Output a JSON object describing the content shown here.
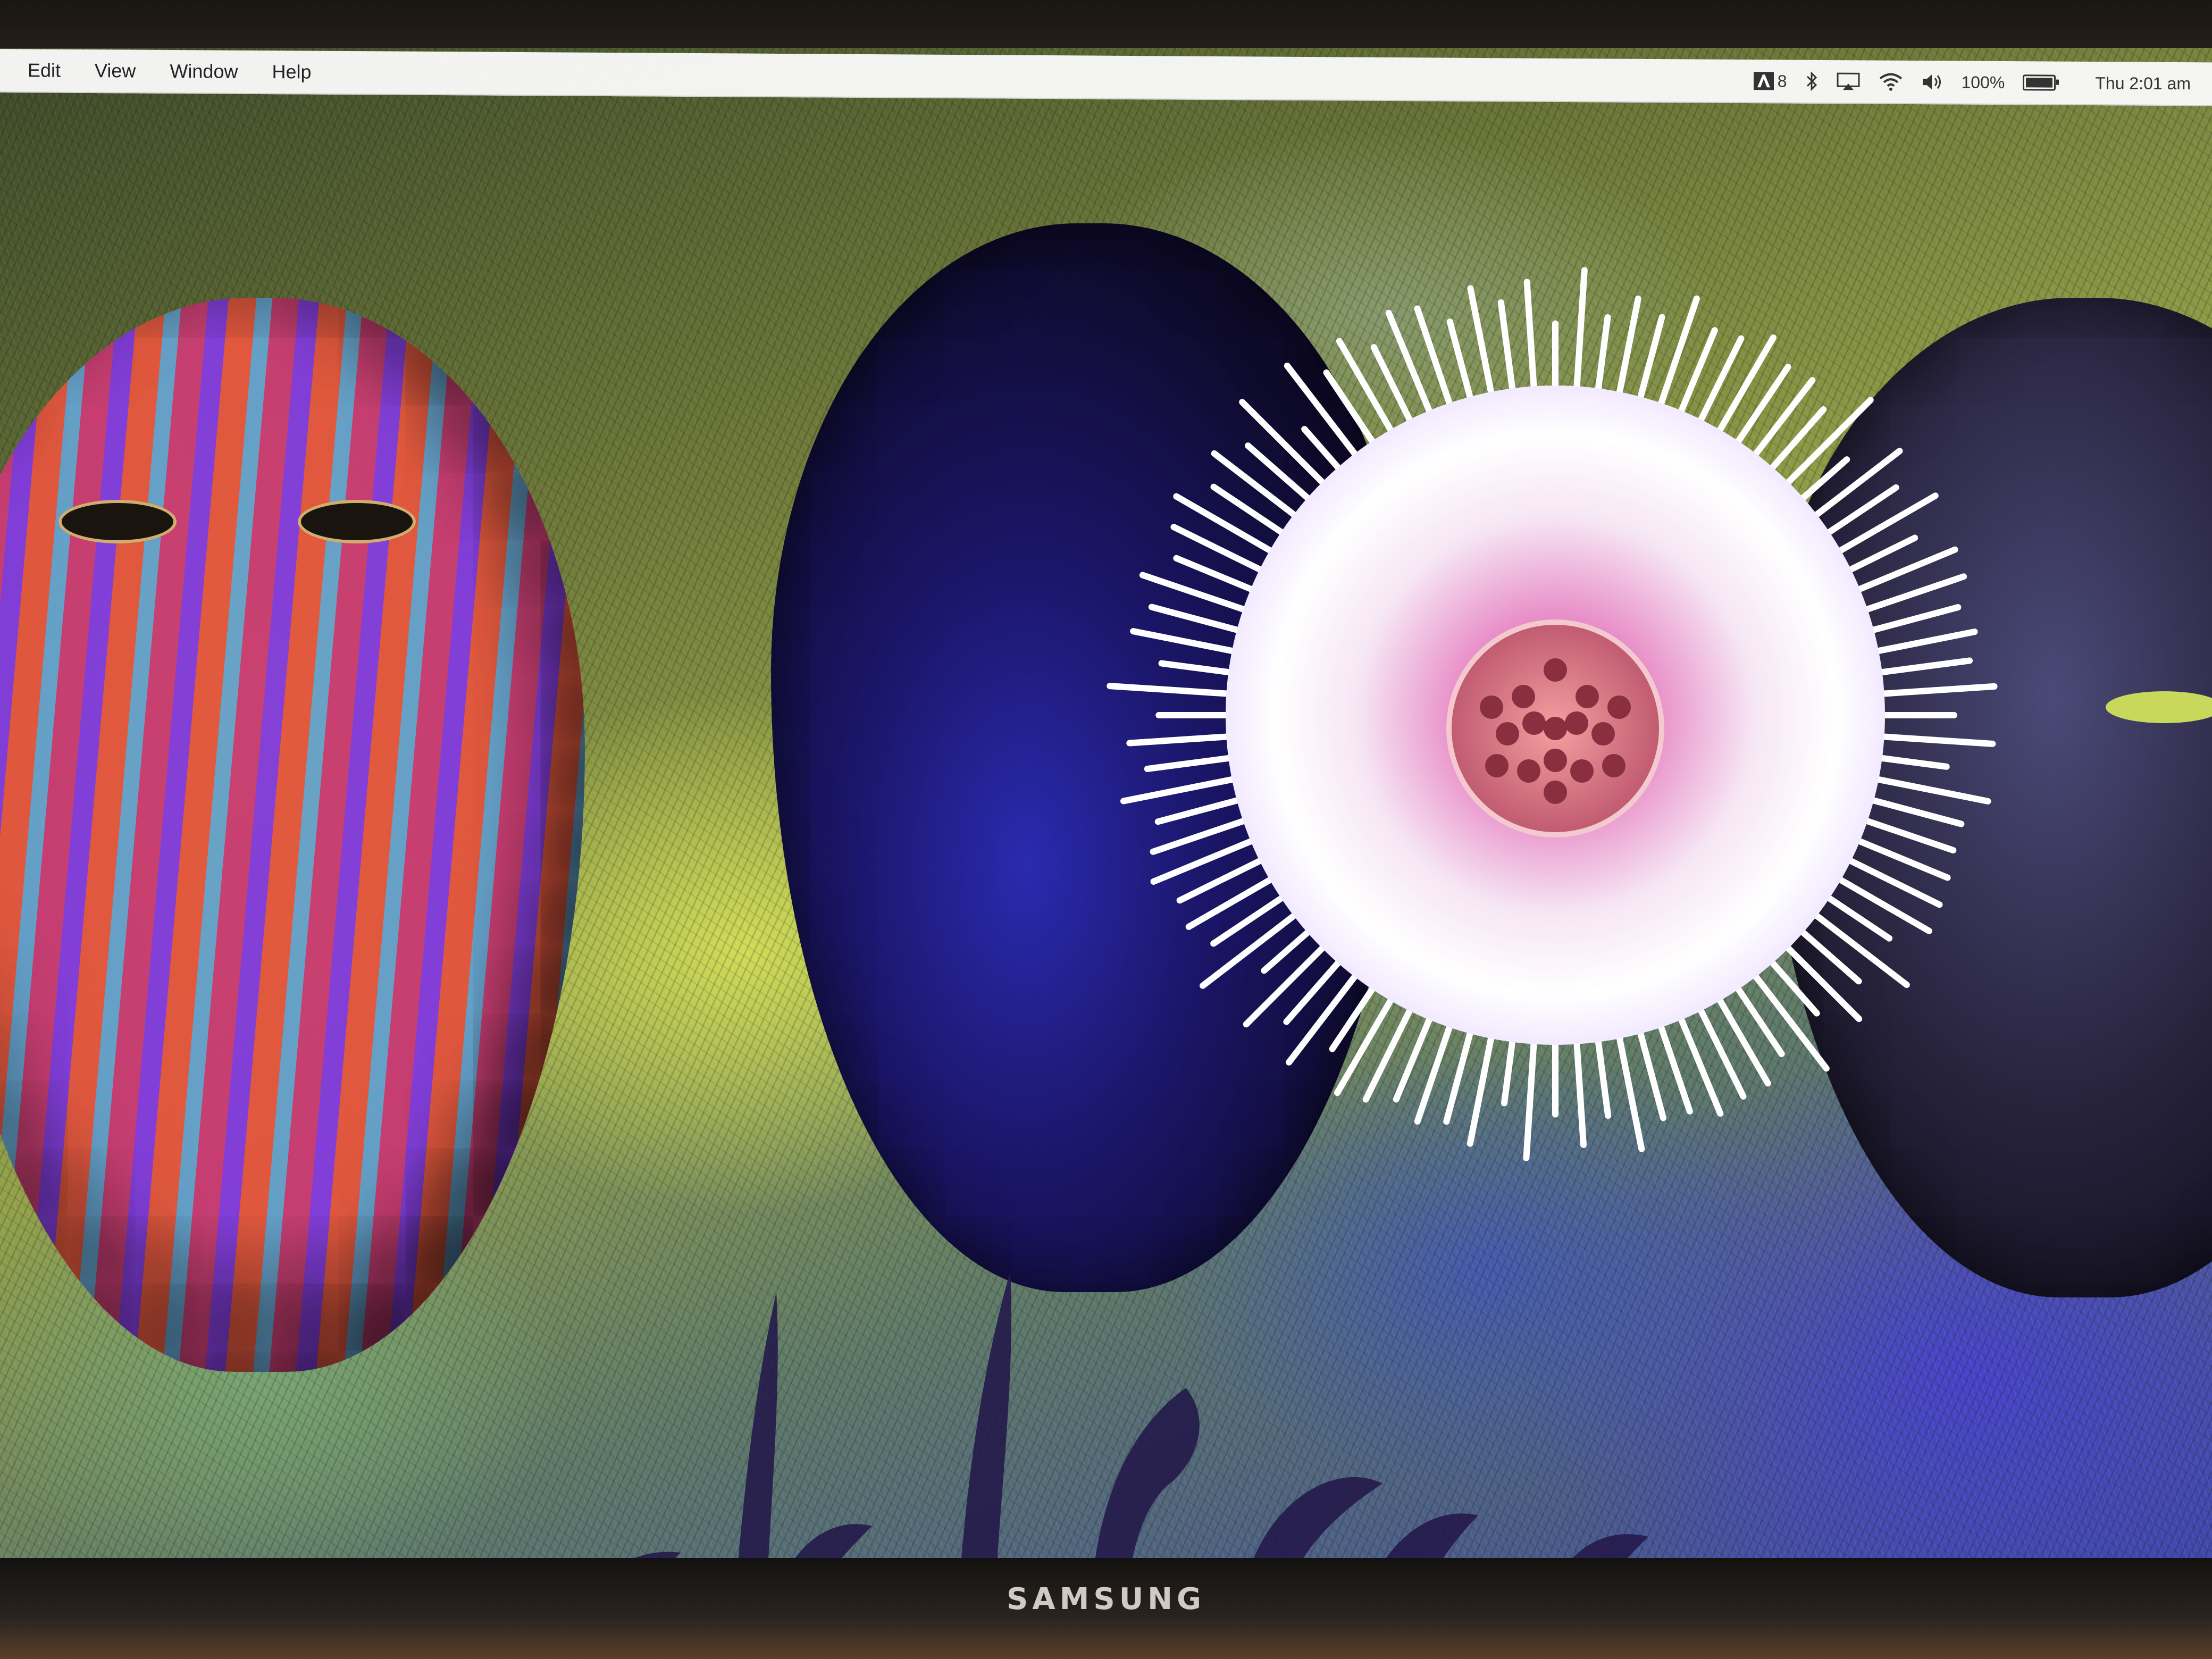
{
  "menubar": {
    "menus": [
      "Edit",
      "View",
      "Window",
      "Help"
    ],
    "status": {
      "adobe_badge": "8",
      "battery_percent": "100%",
      "battery_level": 1.0,
      "clock": "Thu 2:01 am"
    },
    "icons": [
      "adobe-creative-cloud-icon",
      "bluetooth-icon",
      "airplay-icon",
      "wifi-icon",
      "volume-icon",
      "battery-icon"
    ]
  },
  "monitor": {
    "brand": "SAMSUNG"
  },
  "colors": {
    "disc_glow": "#ffffff",
    "disc_center": "#e070c0",
    "menubar_bg": "#fafafa"
  }
}
